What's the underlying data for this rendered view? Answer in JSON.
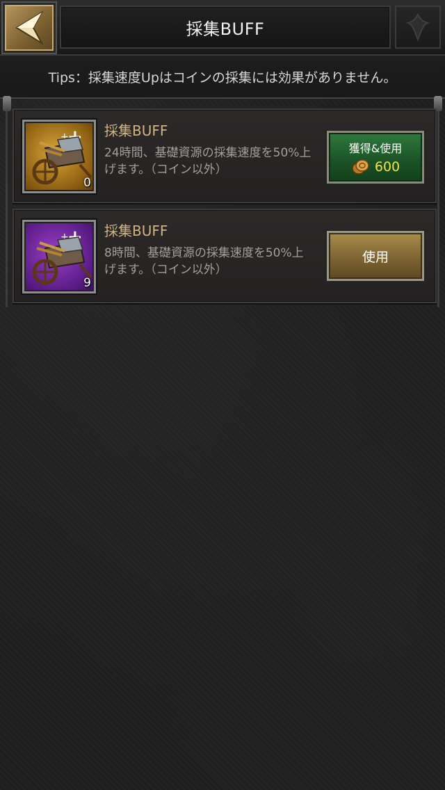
{
  "header": {
    "title": "採集BUFF",
    "back_icon": "chevron-left-icon",
    "ornament_icon": "fleur-ornament-icon"
  },
  "tips": {
    "text": "Tips：採集速度Upはコインの採集には効果がありません。"
  },
  "items": [
    {
      "title": "採集BUFF",
      "description": "24時間、基礎資源の採集速度を50%上げます。（コイン以外）",
      "count": "0",
      "icon": "resource-cart-icon",
      "icon_color": "#d9a638",
      "button": {
        "type": "acquire",
        "label": "獲得&使用",
        "price": "600",
        "currency_icon": "coin-icon"
      }
    },
    {
      "title": "採集BUFF",
      "description": "8時間、基礎資源の採集速度を50%上げます。（コイン以外）",
      "count": "9",
      "icon": "resource-cart-icon",
      "icon_color": "#9a3fc9",
      "button": {
        "type": "use",
        "label": "使用"
      }
    }
  ],
  "colors": {
    "title_gold": "#d0b386",
    "price_yellow": "#f5e14a",
    "acquire_green": "#1a5226",
    "use_gold": "#7a6130"
  }
}
